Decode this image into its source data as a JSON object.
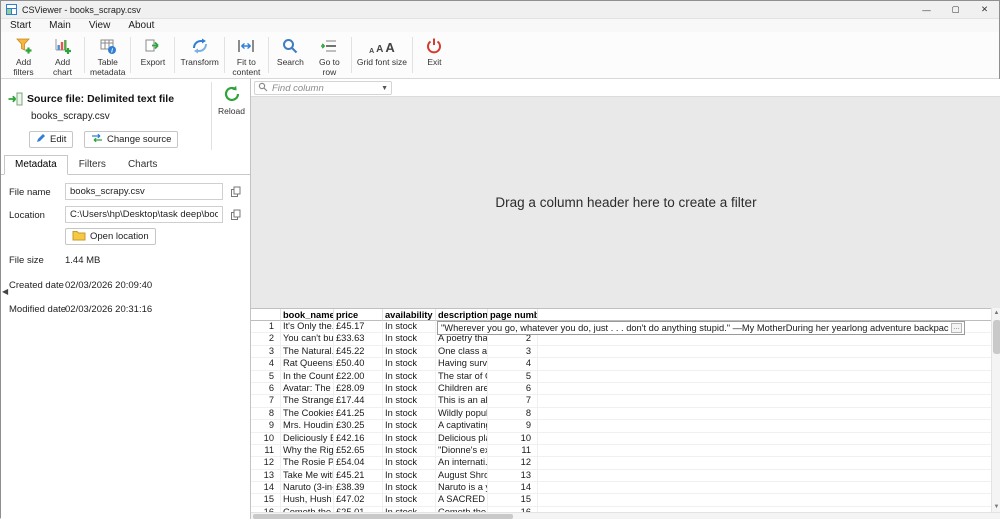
{
  "window": {
    "title": "CSViewer - books_scrapy.csv",
    "minimize": "—",
    "maximize": "▢",
    "close": "✕"
  },
  "menu": {
    "items": [
      "Start",
      "Main",
      "View",
      "About"
    ]
  },
  "toolbar": {
    "buttons": [
      {
        "id": "add-filters",
        "label": "Add\nfilters"
      },
      {
        "id": "add-chart",
        "label": "Add\nchart"
      },
      {
        "id": "table-metadata",
        "label": "Table\nmetadata"
      },
      {
        "id": "export",
        "label": "Export"
      },
      {
        "id": "transform",
        "label": "Transform"
      },
      {
        "id": "fit-to-content",
        "label": "Fit to\ncontent"
      },
      {
        "id": "search",
        "label": "Search"
      },
      {
        "id": "go-to-row",
        "label": "Go to\nrow"
      },
      {
        "id": "grid-font-size",
        "label": "Grid font size"
      },
      {
        "id": "exit",
        "label": "Exit"
      }
    ]
  },
  "source_panel": {
    "title": "Source file: Delimited text file",
    "filename": "books_scrapy.csv",
    "reload_label": "Reload",
    "edit_label": "Edit",
    "change_source_label": "Change source",
    "tabs": [
      "Metadata",
      "Filters",
      "Charts"
    ],
    "active_tab": "Metadata",
    "metadata": {
      "file_name_label": "File name",
      "file_name_value": "books_scrapy.csv",
      "location_label": "Location",
      "location_value": "C:\\Users\\hp\\Desktop\\task deep\\books_scrap",
      "open_location_label": "Open location",
      "file_size_label": "File size",
      "file_size_value": "1.44 MB",
      "created_label": "Created date",
      "created_value": "02/03/2026 20:09:40",
      "modified_label": "Modified date",
      "modified_value": "02/03/2026 20:31:16"
    }
  },
  "find_column": {
    "placeholder": "Find column",
    "caret": "▼"
  },
  "filter_area": {
    "hint": "Drag a column header here to create a filter"
  },
  "colors": {
    "accent_green": "#2ea43a",
    "accent_blue": "#2f7fd6",
    "exit_red": "#d23b2e",
    "funnel_yellow": "#f5b73f",
    "drag_area_bg": "#e9e9e9"
  },
  "grid": {
    "columns": [
      "book_name",
      "price",
      "availability",
      "description",
      "page number"
    ],
    "overlay": {
      "text": "\"Wherever you go, whatever you do, just . . . don't do anything stupid.\" —My MotherDuring her yearlong adventure backpacking from South Africa to Sing...",
      "more": "…"
    },
    "rows": [
      {
        "n": "1",
        "book_name": "It's Only the...",
        "price": "£45.17",
        "availability": "In stock",
        "description": "",
        "page": ""
      },
      {
        "n": "2",
        "book_name": "You can't bur...",
        "price": "£33.63",
        "availability": "In stock",
        "description": "A poetry that...",
        "page": "2"
      },
      {
        "n": "3",
        "book_name": "The Natural...",
        "price": "£45.22",
        "availability": "In stock",
        "description": "One class as...",
        "page": "3"
      },
      {
        "n": "4",
        "book_name": "Rat Queens...",
        "price": "£50.40",
        "availability": "In stock",
        "description": "Having survi...",
        "page": "4"
      },
      {
        "n": "5",
        "book_name": "In the Count...",
        "price": "£22.00",
        "availability": "In stock",
        "description": "The star of O...",
        "page": "5"
      },
      {
        "n": "6",
        "book_name": "Avatar: The L...",
        "price": "£28.09",
        "availability": "In stock",
        "description": "Children are...",
        "page": "6"
      },
      {
        "n": "7",
        "book_name": "The Stranger",
        "price": "£17.44",
        "availability": "In stock",
        "description": "This is an alt...",
        "page": "7"
      },
      {
        "n": "8",
        "book_name": "The Cookies...",
        "price": "£41.25",
        "availability": "In stock",
        "description": "Wildly popul...",
        "page": "8"
      },
      {
        "n": "9",
        "book_name": "Mrs. Houdini",
        "price": "£30.25",
        "availability": "In stock",
        "description": "A captivating...",
        "page": "9"
      },
      {
        "n": "10",
        "book_name": "Deliciously El...",
        "price": "£42.16",
        "availability": "In stock",
        "description": "Delicious pla...",
        "page": "10"
      },
      {
        "n": "11",
        "book_name": "Why the Rig...",
        "price": "£52.65",
        "availability": "In stock",
        "description": "\"Dionne's ex...",
        "page": "11"
      },
      {
        "n": "12",
        "book_name": "The Rosie Pr...",
        "price": "£54.04",
        "availability": "In stock",
        "description": "An internati...",
        "page": "12"
      },
      {
        "n": "13",
        "book_name": "Take Me with...",
        "price": "£45.21",
        "availability": "In stock",
        "description": "August Shro...",
        "page": "13"
      },
      {
        "n": "14",
        "book_name": "Naruto (3-in-...",
        "price": "£38.39",
        "availability": "In stock",
        "description": "Naruto is a y...",
        "page": "14"
      },
      {
        "n": "15",
        "book_name": "Hush, Hush (...",
        "price": "£47.02",
        "availability": "In stock",
        "description": "A SACRED O...",
        "page": "15"
      },
      {
        "n": "16",
        "book_name": "Cometh the...",
        "price": "£25.01",
        "availability": "In stock",
        "description": "Cometh the...",
        "page": "16"
      }
    ]
  }
}
